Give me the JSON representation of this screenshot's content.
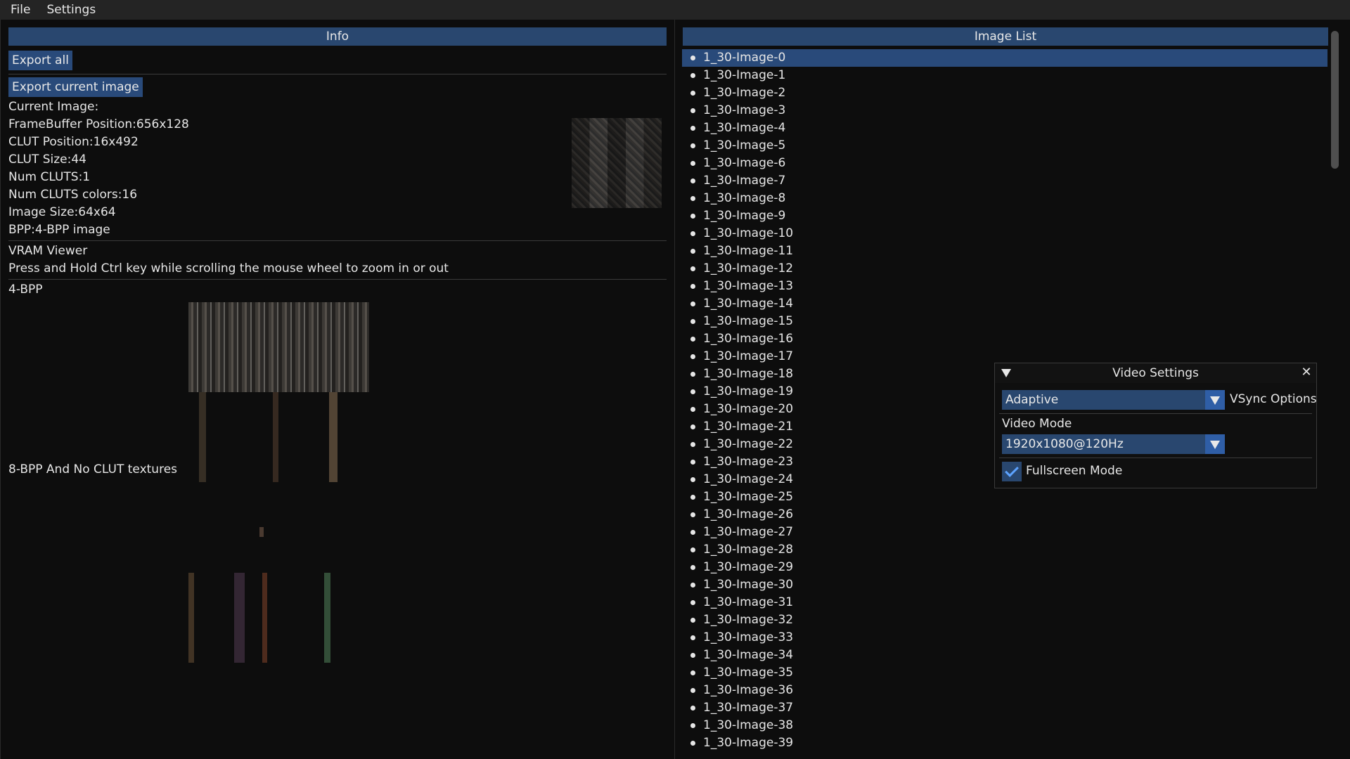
{
  "menu": {
    "file": "File",
    "settings": "Settings"
  },
  "info": {
    "title": "Info",
    "export_all": "Export all",
    "export_current": "Export current image",
    "current_image": "Current Image:",
    "fb_position": "FrameBuffer Position:656x128",
    "clut_position": "CLUT Position:16x492",
    "clut_size": "CLUT Size:44",
    "num_cluts": "Num CLUTS:1",
    "num_clut_colors": "Num CLUTS colors:16",
    "image_size": "Image Size:64x64",
    "bpp": "BPP:4-BPP image",
    "vram_viewer": "VRAM Viewer",
    "vram_hint": "Press and Hold Ctrl key while scrolling the mouse wheel to zoom in or out",
    "label_4bpp": "4-BPP",
    "label_8bpp": "8-BPP And No CLUT textures"
  },
  "image_list": {
    "title": "Image List",
    "selected_index": 0,
    "items": [
      "1_30-Image-0",
      "1_30-Image-1",
      "1_30-Image-2",
      "1_30-Image-3",
      "1_30-Image-4",
      "1_30-Image-5",
      "1_30-Image-6",
      "1_30-Image-7",
      "1_30-Image-8",
      "1_30-Image-9",
      "1_30-Image-10",
      "1_30-Image-11",
      "1_30-Image-12",
      "1_30-Image-13",
      "1_30-Image-14",
      "1_30-Image-15",
      "1_30-Image-16",
      "1_30-Image-17",
      "1_30-Image-18",
      "1_30-Image-19",
      "1_30-Image-20",
      "1_30-Image-21",
      "1_30-Image-22",
      "1_30-Image-23",
      "1_30-Image-24",
      "1_30-Image-25",
      "1_30-Image-26",
      "1_30-Image-27",
      "1_30-Image-28",
      "1_30-Image-29",
      "1_30-Image-30",
      "1_30-Image-31",
      "1_30-Image-32",
      "1_30-Image-33",
      "1_30-Image-34",
      "1_30-Image-35",
      "1_30-Image-36",
      "1_30-Image-37",
      "1_30-Image-38",
      "1_30-Image-39"
    ]
  },
  "video_settings": {
    "title": "Video Settings",
    "vsync_value": "Adaptive",
    "vsync_label": "VSync Options",
    "video_mode_label": "Video Mode",
    "video_mode_value": "1920x1080@120Hz",
    "fullscreen_label": "Fullscreen Mode",
    "fullscreen_checked": true
  }
}
